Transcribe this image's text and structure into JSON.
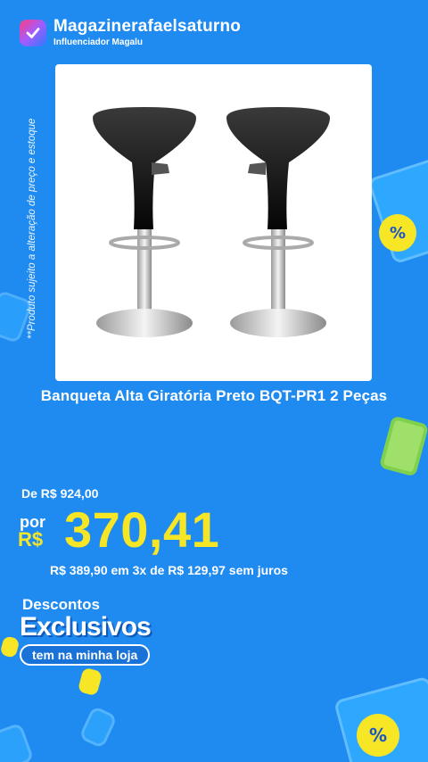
{
  "store": {
    "name": "Magazinerafaelsaturno",
    "subtitle": "Influenciador Magalu"
  },
  "side_note": "**Produto sujeito a alteração de preço e estoque",
  "product": {
    "title": "Banqueta Alta Giratória Preto BQT-PR1 2 Peças",
    "image_alt": "two black swivel bar stools"
  },
  "pricing": {
    "old_price": "De R$ 924,00",
    "por_label": "por",
    "currency": "R$",
    "price": "370,41",
    "installments": "R$ 389,90 em 3x de R$ 129,97 sem juros"
  },
  "promo": {
    "top": "Descontos",
    "main": "Exclusivos",
    "pill": "tem na minha loja"
  },
  "deco": {
    "percent_symbol": "%"
  },
  "colors": {
    "background": "#1f8bf0",
    "price_yellow": "#f6e626"
  }
}
